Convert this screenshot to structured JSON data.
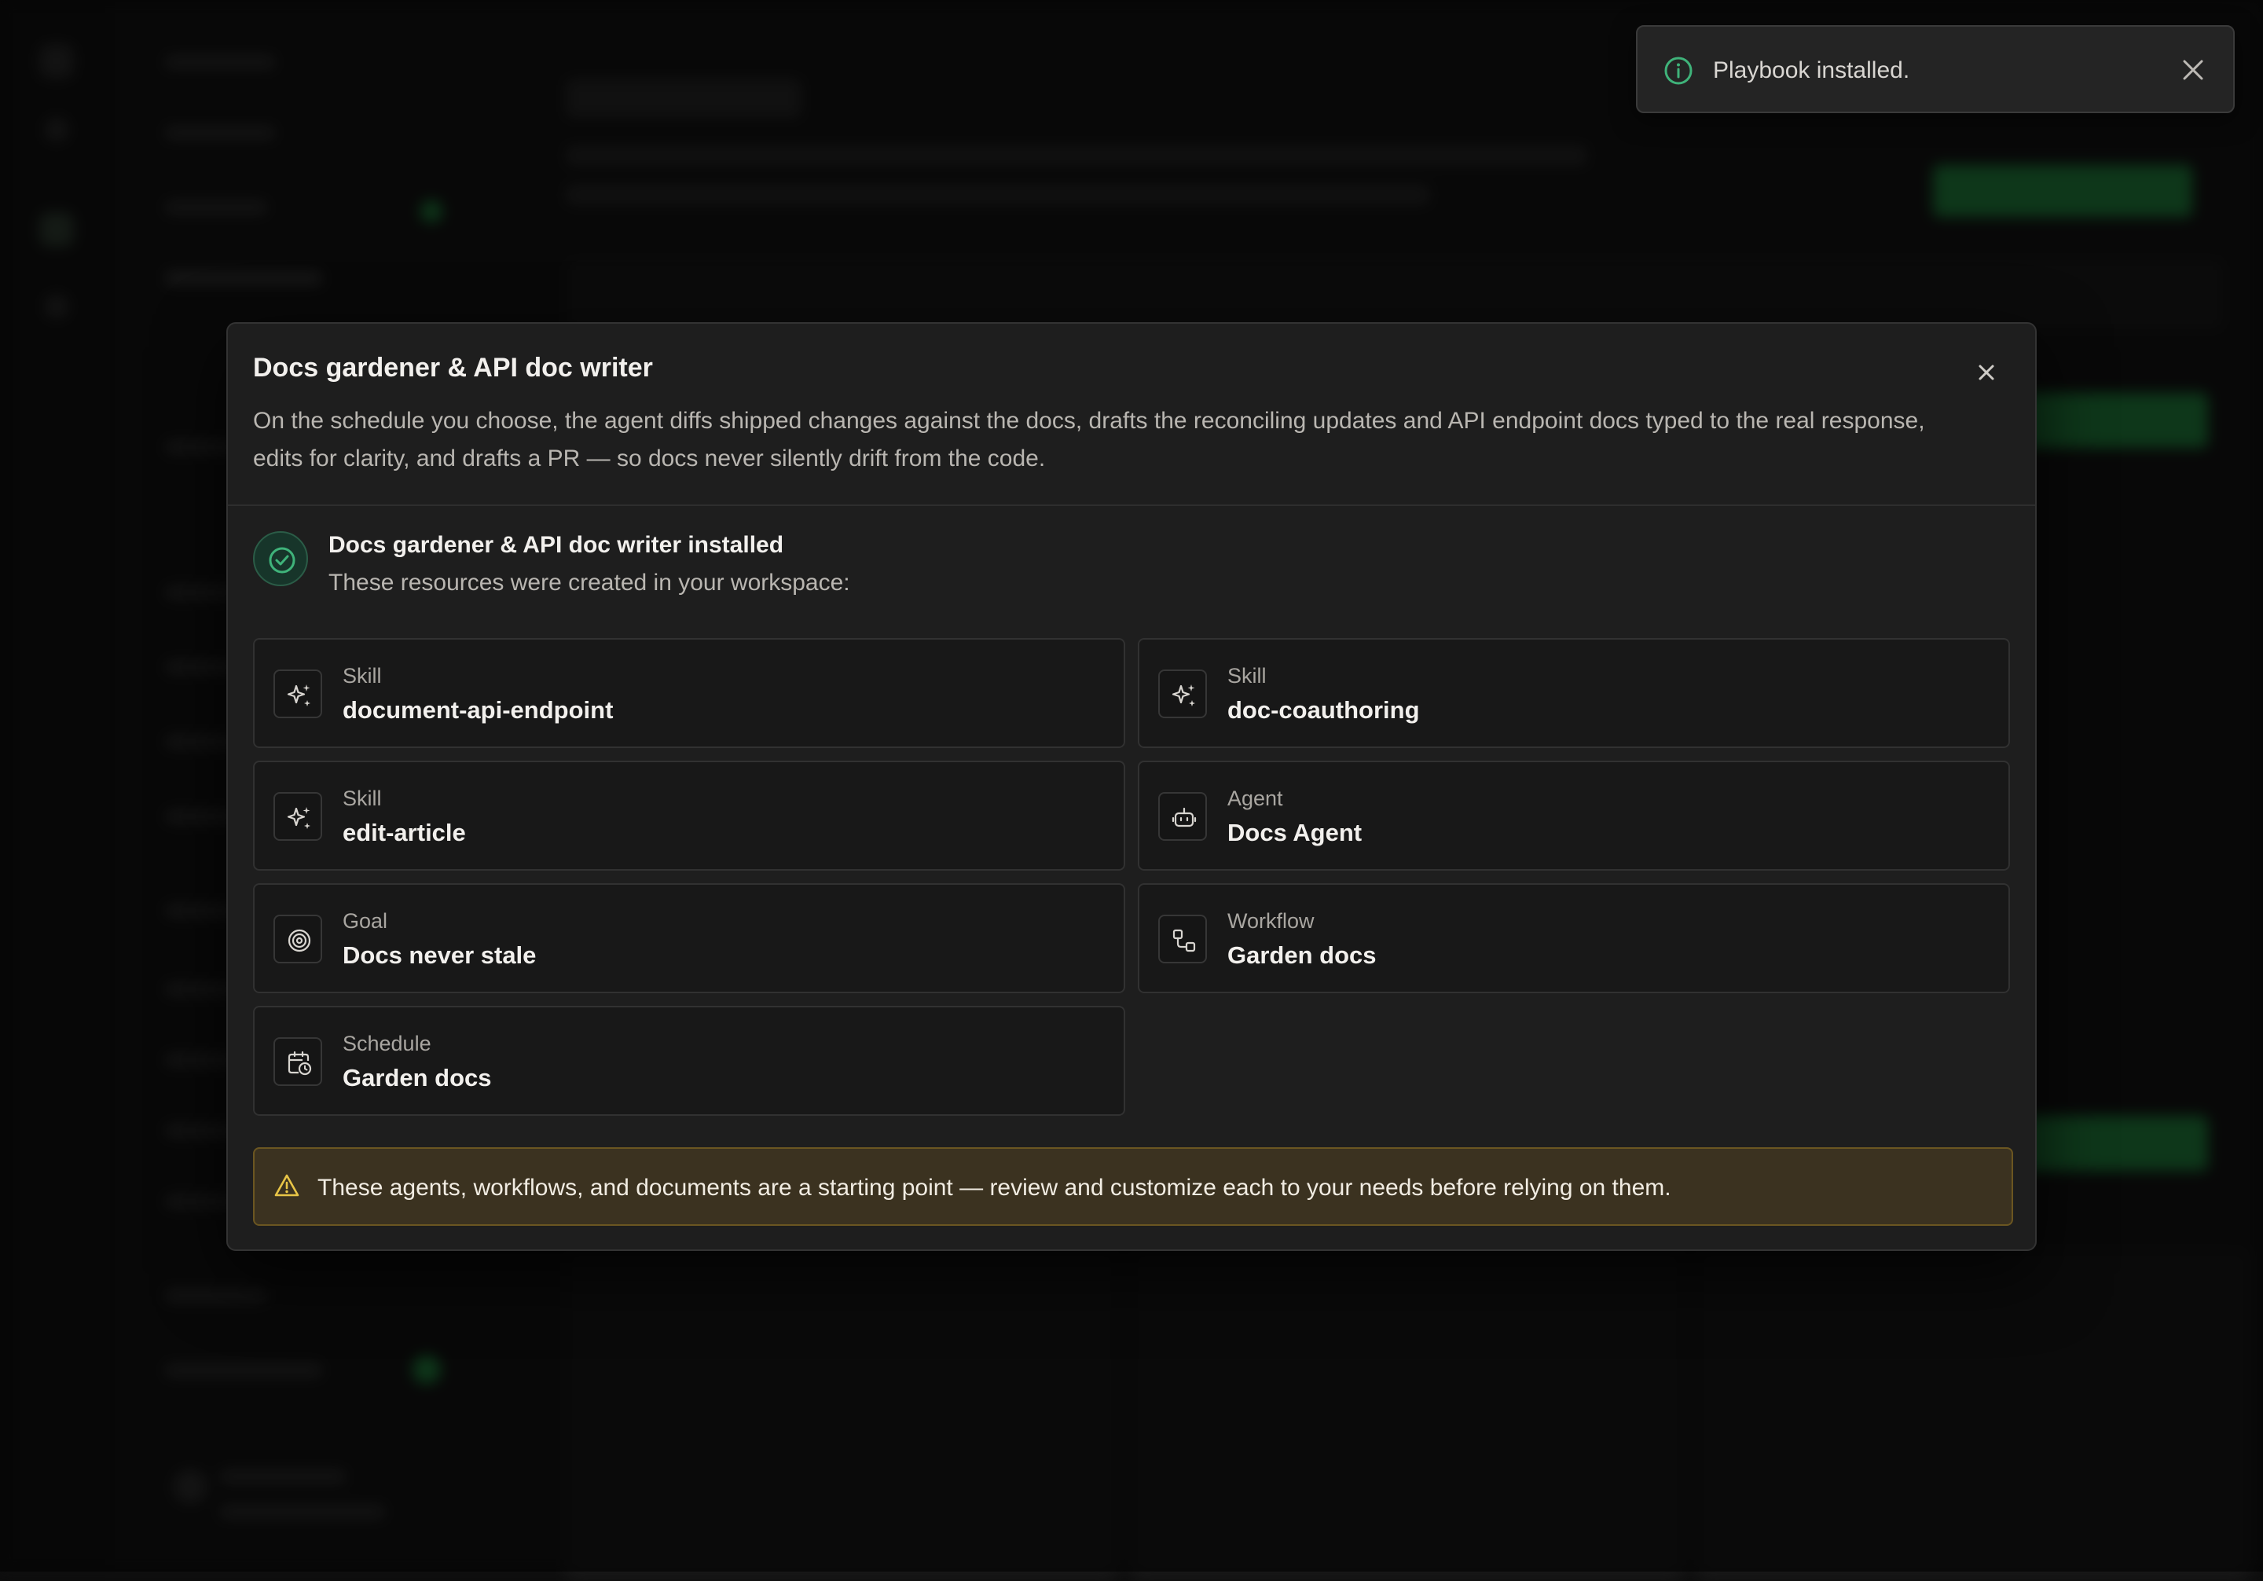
{
  "toast": {
    "message": "Playbook installed."
  },
  "modal": {
    "title": "Docs gardener & API doc writer",
    "description": "On the schedule you choose, the agent diffs shipped changes against the docs, drafts the reconciling updates and API endpoint docs typed to the real response, edits for clarity, and drafts a PR — so docs never silently drift from the code.",
    "success_title": "Docs gardener & API doc writer installed",
    "success_subtitle": "These resources were created in your workspace:",
    "resources": [
      {
        "type": "Skill",
        "name": "document-api-endpoint",
        "icon": "sparkles-icon"
      },
      {
        "type": "Skill",
        "name": "doc-coauthoring",
        "icon": "sparkles-icon"
      },
      {
        "type": "Skill",
        "name": "edit-article",
        "icon": "sparkles-icon"
      },
      {
        "type": "Agent",
        "name": "Docs Agent",
        "icon": "robot-icon"
      },
      {
        "type": "Goal",
        "name": "Docs never stale",
        "icon": "target-icon"
      },
      {
        "type": "Workflow",
        "name": "Garden docs",
        "icon": "workflow-icon"
      },
      {
        "type": "Schedule",
        "name": "Garden docs",
        "icon": "calendar-clock-icon"
      }
    ],
    "warning": "These agents, workflows, and documents are a starting point — review and customize each to your needs before relying on them."
  },
  "colors": {
    "accent_green": "#3fb37a",
    "warning_yellow": "#e8c547",
    "modal_bg": "#1e1e1e"
  }
}
